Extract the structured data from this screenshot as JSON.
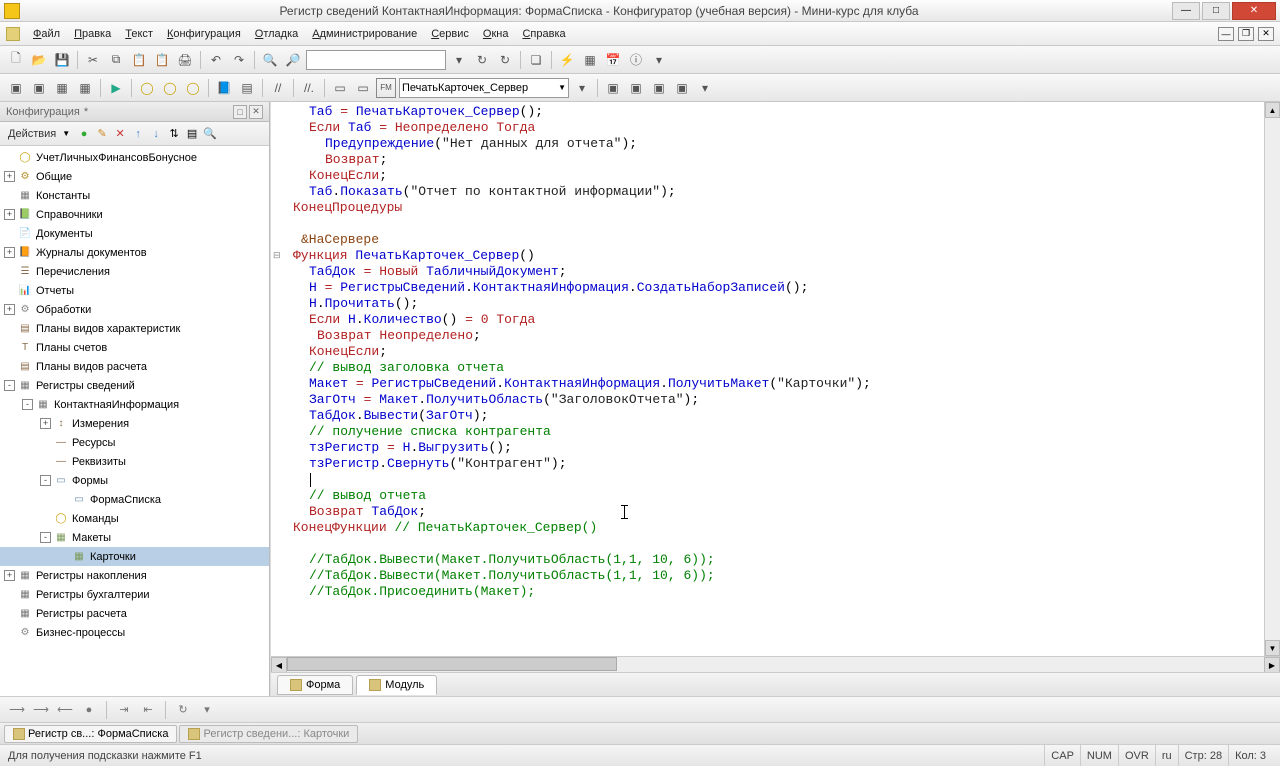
{
  "window": {
    "title": "Регистр сведений КонтактнаяИнформация: ФормаСписка - Конфигуратор (учебная версия) - Мини-курс для клуба"
  },
  "menu": [
    "Файл",
    "Правка",
    "Текст",
    "Конфигурация",
    "Отладка",
    "Администрирование",
    "Сервис",
    "Окна",
    "Справка"
  ],
  "combo_proc": "ПечатьКарточек_Сервер",
  "sidebar": {
    "panel_title": "Конфигурация",
    "actions_label": "Действия",
    "tree": [
      {
        "d": 0,
        "exp": "",
        "icon": "ic-globe",
        "glyph": "◯",
        "label": "УчетЛичныхФинансовБонусное"
      },
      {
        "d": 0,
        "exp": "+",
        "icon": "ic-folder",
        "glyph": "⚙",
        "label": "Общие"
      },
      {
        "d": 0,
        "exp": "",
        "icon": "ic-grid",
        "glyph": "▦",
        "label": "Константы"
      },
      {
        "d": 0,
        "exp": "+",
        "icon": "ic-book",
        "glyph": "📗",
        "label": "Справочники"
      },
      {
        "d": 0,
        "exp": "",
        "icon": "ic-doc",
        "glyph": "📄",
        "label": "Документы"
      },
      {
        "d": 0,
        "exp": "+",
        "icon": "ic-book",
        "glyph": "📙",
        "label": "Журналы документов"
      },
      {
        "d": 0,
        "exp": "",
        "icon": "ic-list",
        "glyph": "☰",
        "label": "Перечисления"
      },
      {
        "d": 0,
        "exp": "",
        "icon": "ic-doc",
        "glyph": "📊",
        "label": "Отчеты"
      },
      {
        "d": 0,
        "exp": "+",
        "icon": "ic-gear",
        "glyph": "⚙",
        "label": "Обработки"
      },
      {
        "d": 0,
        "exp": "",
        "icon": "ic-list",
        "glyph": "▤",
        "label": "Планы видов характеристик"
      },
      {
        "d": 0,
        "exp": "",
        "icon": "ic-list",
        "glyph": "Т",
        "label": "Планы счетов"
      },
      {
        "d": 0,
        "exp": "",
        "icon": "ic-list",
        "glyph": "▤",
        "label": "Планы видов расчета"
      },
      {
        "d": 0,
        "exp": "-",
        "icon": "ic-grid",
        "glyph": "▦",
        "label": "Регистры сведений"
      },
      {
        "d": 1,
        "exp": "-",
        "icon": "ic-grid",
        "glyph": "▦",
        "label": "КонтактнаяИнформация"
      },
      {
        "d": 2,
        "exp": "+",
        "icon": "ic-list",
        "glyph": "↕",
        "label": "Измерения"
      },
      {
        "d": 2,
        "exp": "",
        "icon": "ic-list",
        "glyph": "—",
        "label": "Ресурсы"
      },
      {
        "d": 2,
        "exp": "",
        "icon": "ic-list",
        "glyph": "—",
        "label": "Реквизиты"
      },
      {
        "d": 2,
        "exp": "-",
        "icon": "ic-form",
        "glyph": "▭",
        "label": "Формы"
      },
      {
        "d": 3,
        "exp": "",
        "icon": "ic-form",
        "glyph": "▭",
        "label": "ФормаСписка"
      },
      {
        "d": 2,
        "exp": "",
        "icon": "ic-cmd",
        "glyph": "◯",
        "label": "Команды"
      },
      {
        "d": 2,
        "exp": "-",
        "icon": "ic-lay",
        "glyph": "▦",
        "label": "Макеты"
      },
      {
        "d": 3,
        "exp": "",
        "icon": "ic-lay",
        "glyph": "▦",
        "label": "Карточки",
        "selected": true
      },
      {
        "d": 0,
        "exp": "+",
        "icon": "ic-grid",
        "glyph": "▦",
        "label": "Регистры накопления"
      },
      {
        "d": 0,
        "exp": "",
        "icon": "ic-grid",
        "glyph": "▦",
        "label": "Регистры бухгалтерии"
      },
      {
        "d": 0,
        "exp": "",
        "icon": "ic-grid",
        "glyph": "▦",
        "label": "Регистры расчета"
      },
      {
        "d": 0,
        "exp": "",
        "icon": "ic-gear",
        "glyph": "⚙",
        "label": "Бизнес-процессы"
      }
    ]
  },
  "tabs": {
    "form": "Форма",
    "module": "Модуль"
  },
  "wtabs": {
    "a": "Регистр св...: ФормаСписка",
    "b": "Регистр сведени...: Карточки"
  },
  "status": {
    "hint": "Для получения подсказки нажмите F1",
    "cap": "CAP",
    "num": "NUM",
    "ovr": "OVR",
    "lang": "ru",
    "line": "Стр: 28",
    "col": "Кол: 3"
  }
}
